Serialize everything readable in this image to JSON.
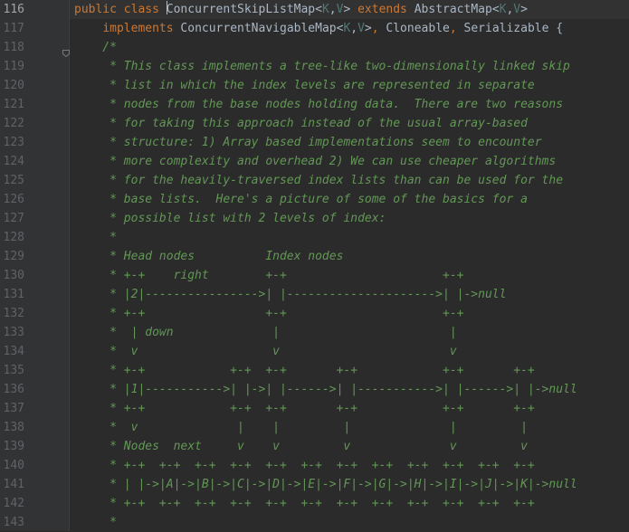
{
  "lines": [
    {
      "num": "116",
      "current": true,
      "segments": [
        {
          "t": "public",
          "c": "kw"
        },
        {
          "t": " "
        },
        {
          "t": "class",
          "c": "kw"
        },
        {
          "t": " "
        },
        {
          "caret": true
        },
        {
          "t": "ConcurrentSkipListMap<"
        },
        {
          "t": "K",
          "c": "tp"
        },
        {
          "t": ","
        },
        {
          "t": "V",
          "c": "tp"
        },
        {
          "t": "> "
        },
        {
          "t": "extends",
          "c": "kw"
        },
        {
          "t": " AbstractMap<"
        },
        {
          "t": "K",
          "c": "tp"
        },
        {
          "t": ","
        },
        {
          "t": "V",
          "c": "tp"
        },
        {
          "t": ">"
        }
      ]
    },
    {
      "num": "117",
      "segments": [
        {
          "t": "    "
        },
        {
          "t": "implements",
          "c": "kw"
        },
        {
          "t": " ConcurrentNavigableMap<"
        },
        {
          "t": "K",
          "c": "tp"
        },
        {
          "t": ","
        },
        {
          "t": "V",
          "c": "tp"
        },
        {
          "t": ">"
        },
        {
          "t": ", ",
          "c": "kw"
        },
        {
          "t": "Cloneable"
        },
        {
          "t": ", ",
          "c": "kw"
        },
        {
          "t": "Serializable {"
        }
      ]
    },
    {
      "num": "118",
      "segments": [
        {
          "t": "    /*",
          "c": "cm"
        }
      ]
    },
    {
      "num": "119",
      "segments": [
        {
          "t": "     * This class implements a tree-like two-dimensionally linked skip",
          "c": "cm"
        }
      ]
    },
    {
      "num": "120",
      "segments": [
        {
          "t": "     * list in which the index levels are represented in separate",
          "c": "cm"
        }
      ]
    },
    {
      "num": "121",
      "segments": [
        {
          "t": "     * nodes from the base nodes holding data.  There are two reasons",
          "c": "cm"
        }
      ]
    },
    {
      "num": "122",
      "segments": [
        {
          "t": "     * for taking this approach instead of the usual array-based",
          "c": "cm"
        }
      ]
    },
    {
      "num": "123",
      "segments": [
        {
          "t": "     * structure: 1) Array based implementations seem to encounter",
          "c": "cm"
        }
      ]
    },
    {
      "num": "124",
      "segments": [
        {
          "t": "     * more complexity and overhead 2) We can use cheaper algorithms",
          "c": "cm"
        }
      ]
    },
    {
      "num": "125",
      "segments": [
        {
          "t": "     * for the heavily-traversed index lists than can be used for the",
          "c": "cm"
        }
      ]
    },
    {
      "num": "126",
      "segments": [
        {
          "t": "     * base lists.  Here's a picture of some of the basics for a",
          "c": "cm"
        }
      ]
    },
    {
      "num": "127",
      "segments": [
        {
          "t": "     * possible list with 2 levels of index:",
          "c": "cm"
        }
      ]
    },
    {
      "num": "128",
      "segments": [
        {
          "t": "     *",
          "c": "cm"
        }
      ]
    },
    {
      "num": "129",
      "segments": [
        {
          "t": "     * Head nodes          Index nodes",
          "c": "cm"
        }
      ]
    },
    {
      "num": "130",
      "segments": [
        {
          "t": "     * +-+    right        +-+                      +-+",
          "c": "cm"
        }
      ]
    },
    {
      "num": "131",
      "segments": [
        {
          "t": "     * |2|---------------->| |--------------------->| |->null",
          "c": "cm"
        }
      ]
    },
    {
      "num": "132",
      "segments": [
        {
          "t": "     * +-+                 +-+                      +-+",
          "c": "cm"
        }
      ]
    },
    {
      "num": "133",
      "segments": [
        {
          "t": "     *  | down              |                        |",
          "c": "cm"
        }
      ]
    },
    {
      "num": "134",
      "segments": [
        {
          "t": "     *  v                   v                        v",
          "c": "cm"
        }
      ]
    },
    {
      "num": "135",
      "segments": [
        {
          "t": "     * +-+            +-+  +-+       +-+            +-+       +-+",
          "c": "cm"
        }
      ]
    },
    {
      "num": "136",
      "segments": [
        {
          "t": "     * |1|----------->| |->| |------>| |----------->| |------>| |->null",
          "c": "cm"
        }
      ]
    },
    {
      "num": "137",
      "segments": [
        {
          "t": "     * +-+            +-+  +-+       +-+            +-+       +-+",
          "c": "cm"
        }
      ]
    },
    {
      "num": "138",
      "segments": [
        {
          "t": "     *  v              |    |         |              |         |",
          "c": "cm"
        }
      ]
    },
    {
      "num": "139",
      "segments": [
        {
          "t": "     * Nodes  next     v    v         v              v         v",
          "c": "cm"
        }
      ]
    },
    {
      "num": "140",
      "segments": [
        {
          "t": "     * +-+  +-+  +-+  +-+  +-+  +-+  +-+  +-+  +-+  +-+  +-+  +-+",
          "c": "cm"
        }
      ]
    },
    {
      "num": "141",
      "segments": [
        {
          "t": "     * | |->|A|->|B|->|C|->|D|->|E|->|F|->|G|->|H|->|I|->|J|->|K|->null",
          "c": "cm"
        }
      ]
    },
    {
      "num": "142",
      "segments": [
        {
          "t": "     * +-+  +-+  +-+  +-+  +-+  +-+  +-+  +-+  +-+  +-+  +-+  +-+",
          "c": "cm"
        }
      ]
    },
    {
      "num": "143",
      "segments": [
        {
          "t": "     *",
          "c": "cm"
        }
      ]
    }
  ],
  "colors": {
    "background": "#2b2b2b",
    "gutter": "#313335",
    "keyword": "#cc7832",
    "type_param": "#507874",
    "comment": "#629755",
    "text": "#a9b7c6",
    "line_number": "#606366"
  },
  "icons": {
    "fold": "fold-marker-icon"
  }
}
